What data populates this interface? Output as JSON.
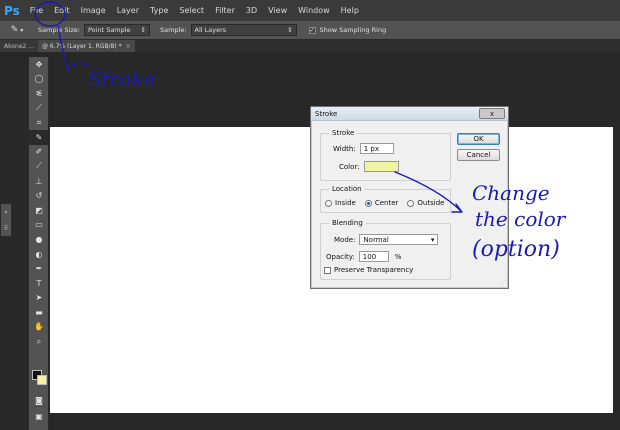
{
  "app": {
    "logo": "Ps"
  },
  "menu": [
    "File",
    "Edit",
    "Image",
    "Layer",
    "Type",
    "Select",
    "Filter",
    "3D",
    "View",
    "Window",
    "Help"
  ],
  "options": {
    "sample_size_label": "Sample Size:",
    "sample_size_value": "Point Sample",
    "sample_label": "Sample:",
    "sample_value": "All Layers",
    "ring_label": "Show Sampling Ring",
    "ring_checked": true
  },
  "tabs": [
    {
      "label": "Akone2 ..."
    },
    {
      "label": "@ 6.7% (Layer 1, RGB/8) *"
    }
  ],
  "tools": [
    "move",
    "ellipse-marquee",
    "lasso",
    "quick-selection",
    "crop",
    "eyedropper",
    "spot-healing",
    "brush",
    "clone-stamp",
    "history-brush",
    "eraser",
    "gradient",
    "blur",
    "dodge",
    "pen",
    "type",
    "path-selection",
    "rectangle",
    "hand",
    "zoom"
  ],
  "colors": {
    "foreground": "#111111",
    "background": "#f1f3a3",
    "stroke_color": "#f1f3a3"
  },
  "dialog": {
    "title": "Stroke",
    "close": "x",
    "stroke_group": "Stroke",
    "width_label": "Width:",
    "width_value": "1 px",
    "color_label": "Color:",
    "location_group": "Location",
    "location_options": [
      "Inside",
      "Center",
      "Outside"
    ],
    "location_selected": "Center",
    "blending_group": "Blending",
    "mode_label": "Mode:",
    "mode_value": "Normal",
    "opacity_label": "Opacity:",
    "opacity_value": "100",
    "opacity_unit": "%",
    "preserve_label": "Preserve Transparency",
    "ok": "OK",
    "cancel": "Cancel"
  },
  "annotations": {
    "stroke_note": "Stroke",
    "color_note": [
      "Change",
      "the color",
      "(option)"
    ]
  }
}
